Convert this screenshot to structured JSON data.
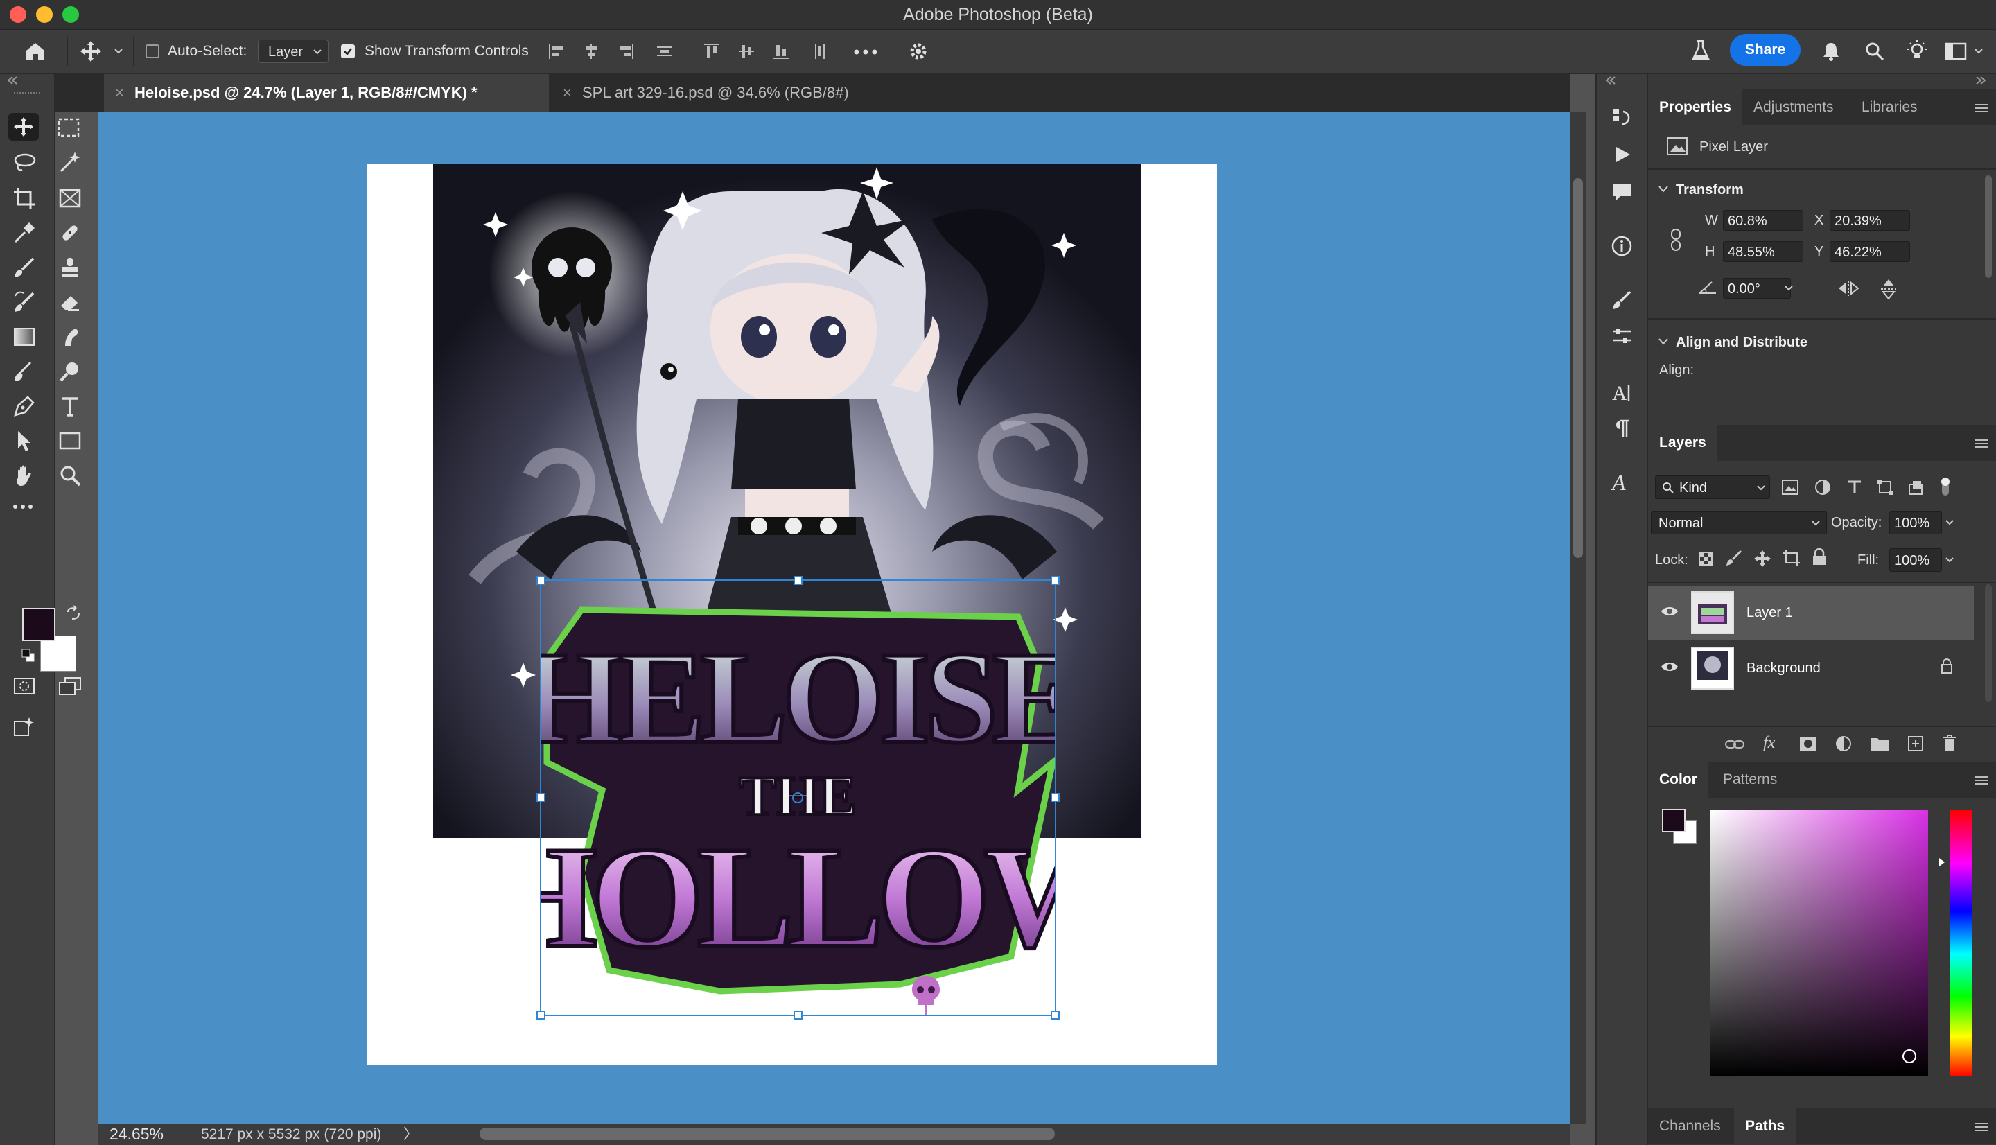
{
  "window": {
    "title": "Adobe Photoshop (Beta)",
    "traffic_colors": [
      "#ff5f57",
      "#febc2e",
      "#28c840"
    ]
  },
  "options_bar": {
    "auto_select_label": "Auto-Select:",
    "auto_select_checked": false,
    "auto_select_value": "Layer",
    "show_transform_label": "Show Transform Controls",
    "show_transform_checked": true,
    "share_label": "Share",
    "icons": [
      "home-icon",
      "move-icon",
      "align-left-icon",
      "align-center-icon",
      "align-right-icon",
      "distribute-icon",
      "align-top-icon",
      "align-middle-icon",
      "align-bottom-icon",
      "more-icon",
      "settings-icon",
      "flask-icon",
      "bell-icon",
      "search-icon",
      "lightbulb-icon",
      "workspace-icon"
    ]
  },
  "tabs": [
    {
      "label": "Heloise.psd @ 24.7% (Layer 1, RGB/8#/CMYK) *",
      "active": true
    },
    {
      "label": "SPL art 329-16.psd @ 34.6% (RGB/8#)",
      "active": false
    }
  ],
  "toolbar": {
    "tools": [
      "move-tool",
      "marquee-tool",
      "lasso-tool",
      "magic-wand-tool",
      "crop-tool",
      "frame-tool",
      "eyedropper-tool",
      "healing-tool",
      "brush-tool",
      "stamp-tool",
      "history-brush-tool",
      "eraser-tool",
      "gradient-tool",
      "smudge-tool",
      "blur-tool",
      "dodge-tool",
      "pen-tool",
      "type-tool",
      "path-select-tool",
      "rectangle-tool",
      "hand-tool",
      "zoom-tool",
      "more-tools"
    ],
    "foreground_color": "#1a0a1a",
    "background_color": "#ffffff"
  },
  "canvas": {
    "background_color": "#4b8fc7",
    "artwork_text": {
      "line1": "HELOISE",
      "line2": "THE",
      "line3": "HOLLOW"
    }
  },
  "status": {
    "zoom": "24.65%",
    "doc_info": "5217 px x 5532 px (720 ppi)",
    "arrow": "〉"
  },
  "properties": {
    "tabs": [
      "Properties",
      "Adjustments",
      "Libraries"
    ],
    "layer_type": "Pixel Layer",
    "transform_title": "Transform",
    "w_label": "W",
    "w_value": "60.8%",
    "h_label": "H",
    "h_value": "48.55%",
    "x_label": "X",
    "x_value": "20.39%",
    "y_label": "Y",
    "y_value": "46.22%",
    "angle_value": "0.00°",
    "align_title": "Align and Distribute",
    "align_label": "Align:"
  },
  "layers": {
    "tab": "Layers",
    "filter_value": "Kind",
    "blend_mode": "Normal",
    "opacity_label": "Opacity:",
    "opacity_value": "100%",
    "lock_label": "Lock:",
    "fill_label": "Fill:",
    "fill_value": "100%",
    "items": [
      {
        "name": "Layer 1",
        "visible": true,
        "selected": true,
        "locked": false
      },
      {
        "name": "Background",
        "visible": true,
        "selected": false,
        "locked": true
      }
    ]
  },
  "color_panel": {
    "tabs": [
      "Color",
      "Patterns"
    ],
    "hue_color": "#d930e6"
  },
  "bottom_panel": {
    "tabs": [
      "Channels",
      "Paths"
    ]
  }
}
